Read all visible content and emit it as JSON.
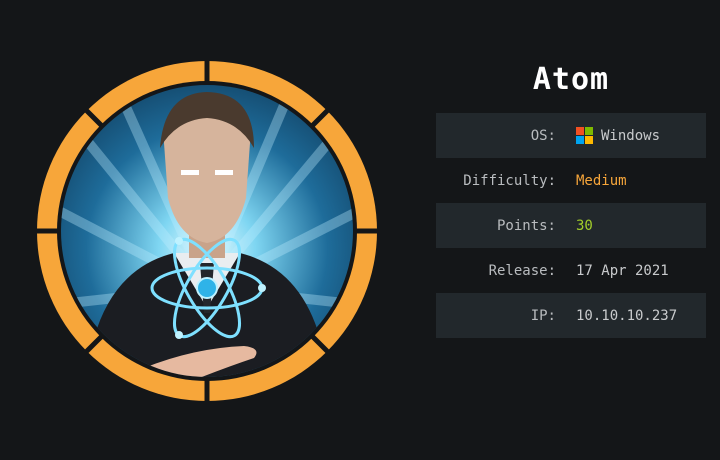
{
  "machine": {
    "name": "Atom",
    "fields": [
      {
        "label": "OS:",
        "value": "Windows",
        "icon": "windows-logo-icon"
      },
      {
        "label": "Difficulty:",
        "value": "Medium"
      },
      {
        "label": "Points:",
        "value": "30"
      },
      {
        "label": "Release:",
        "value": "17 Apr 2021"
      },
      {
        "label": "IP:",
        "value": "10.10.10.237"
      }
    ]
  },
  "colors": {
    "background": "#141618",
    "ring": "#f7a63a",
    "difficulty": "#f7a63a",
    "points": "#a2cd2a",
    "row_shade": "#22282c",
    "windows_red": "#f25022",
    "windows_green": "#7fba00",
    "windows_blue": "#00a4ef",
    "windows_yellow": "#ffb900"
  },
  "avatar": {
    "icon": "atom-man-avatar-icon"
  }
}
